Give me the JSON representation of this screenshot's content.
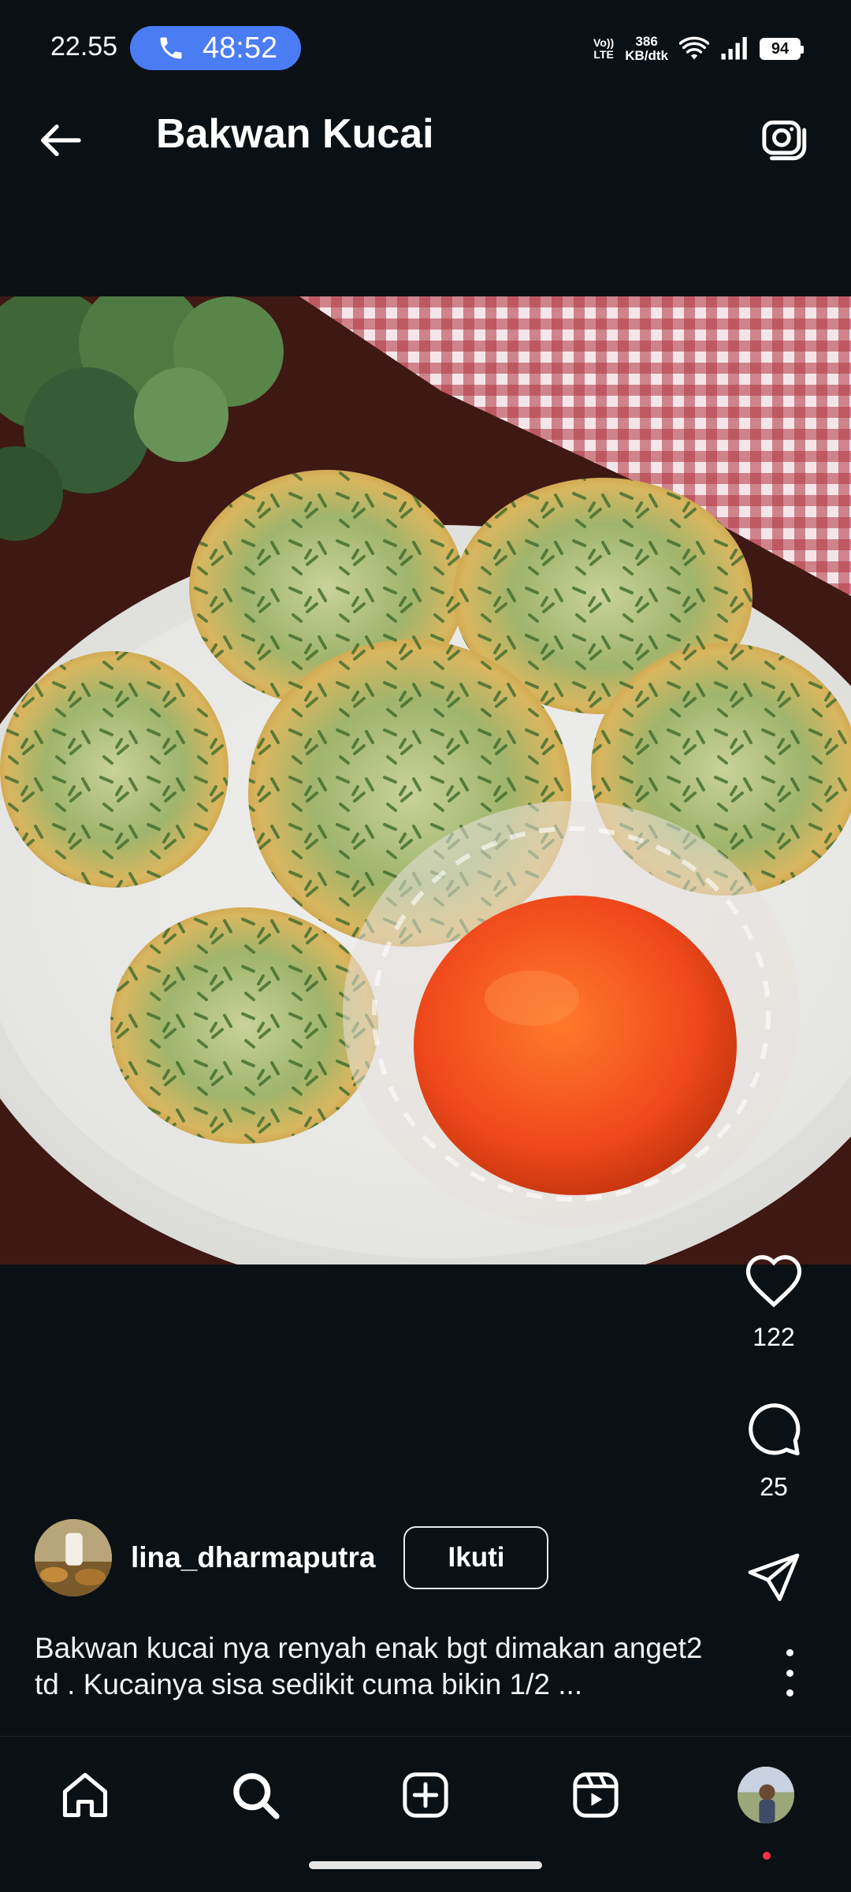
{
  "status_bar": {
    "time": "22.55",
    "call_timer": "48:52",
    "volte_line1": "Vo))",
    "volte_line2": "LTE",
    "speed_value": "386",
    "speed_unit": "KB/dtk",
    "battery": "94"
  },
  "header": {
    "title": "Bakwan Kucai"
  },
  "post": {
    "likes": "122",
    "comments": "25",
    "username": "lina_dharmaputra",
    "follow_label": "Ikuti",
    "caption_line1": "Bakwan kucai nya renyah enak bgt dimakan anget2",
    "caption_line2": "td . Kucainya sisa sedikit cuma bikin 1/2 ..."
  },
  "colors": {
    "background": "#0b1014",
    "call_pill": "#4a7cf4",
    "notification_dot": "#ff3040"
  },
  "icons": {
    "back": "arrow-left-icon",
    "camera": "camera-icon",
    "like": "heart-icon",
    "comment": "comment-bubble-icon",
    "share": "paper-plane-icon",
    "more": "more-vertical-icon",
    "nav": [
      "home-icon",
      "search-icon",
      "plus-square-icon",
      "reels-icon",
      "profile-avatar"
    ]
  }
}
